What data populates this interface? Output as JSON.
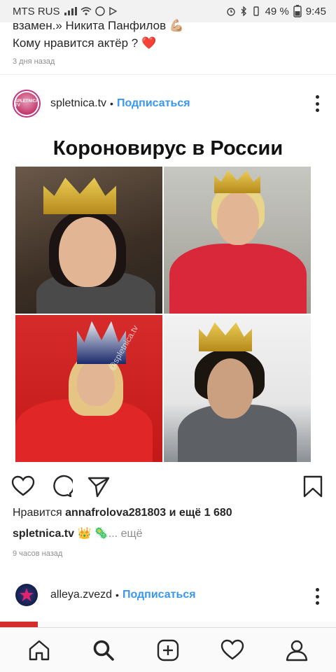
{
  "status_bar": {
    "carrier": "MTS RUS",
    "battery": "49 %",
    "time": "9:45"
  },
  "previous_post": {
    "caption_line1": "взамен.» Никита Панфилов 💪🏼",
    "caption_line2": "Кому нравится актёр ? ❤️",
    "time": "3 дня назад"
  },
  "post": {
    "username": "spletnica.tv",
    "separator": "•",
    "follow_label": "Подписаться",
    "image_title": "Короновирус в России",
    "watermark": "@spletnica.tv",
    "likes_prefix": "Нравится",
    "likes_user": "annafrolova281803",
    "likes_suffix": "и ещё 1 680",
    "caption_user": "spletnica.tv",
    "caption_text": "👑 🦠",
    "caption_more": "... ещё",
    "time": "9 часов назад",
    "avatar_text": "SPLETNICA TV"
  },
  "next_post": {
    "username": "alleya.zvezd",
    "separator": "•",
    "follow_label": "Подписаться"
  },
  "colors": {
    "link_blue": "#3897f0",
    "text": "#262626",
    "muted": "#8e8e8e"
  },
  "icons": {
    "like": "heart-icon",
    "comment": "comment-icon",
    "share": "send-icon",
    "save": "bookmark-icon",
    "nav": [
      "home-icon",
      "search-icon",
      "add-icon",
      "heart-icon",
      "profile-icon"
    ]
  }
}
